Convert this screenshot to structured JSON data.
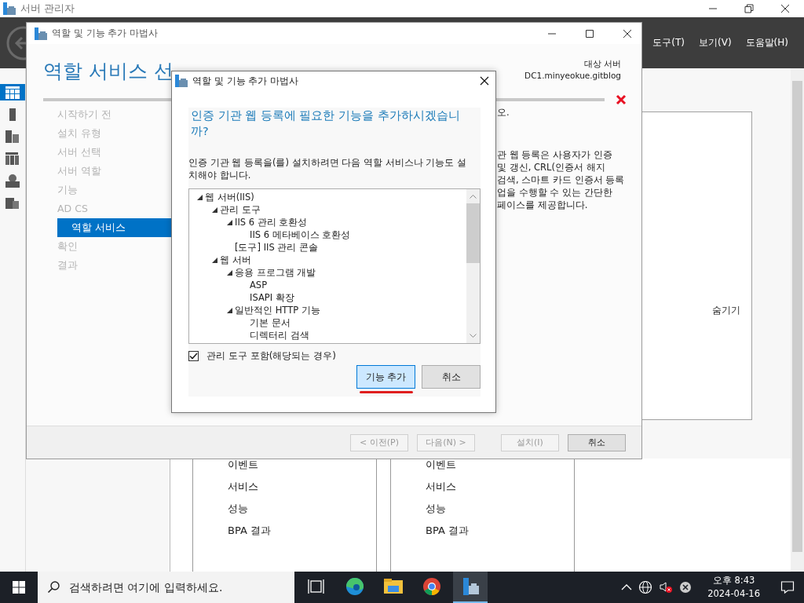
{
  "server_manager": {
    "title": "서버 관리자",
    "menu": [
      {
        "label": "도구(T)"
      },
      {
        "label": "보기(V)"
      },
      {
        "label": "도움말(H)"
      }
    ],
    "nav_icons": [
      {
        "kind": "dashboard",
        "selected": true
      },
      {
        "kind": "local",
        "selected": false
      },
      {
        "kind": "all",
        "selected": false
      },
      {
        "kind": "adcs",
        "selected": false
      },
      {
        "kind": "iis",
        "selected": false
      },
      {
        "kind": "files",
        "selected": false
      }
    ],
    "hide_link": "숨기기",
    "tiles": [
      {
        "items": [
          "이벤트",
          "서비스",
          "성능",
          "BPA 결과"
        ]
      },
      {
        "items": [
          "이벤트",
          "서비스",
          "성능",
          "BPA 결과"
        ]
      }
    ]
  },
  "wizard": {
    "title": "역할 및 기능 추가 마법사",
    "heading": "역할 서비스 선",
    "target_label": "대상 서버",
    "target_server": "DC1.minyeokue.gitblog",
    "steps": [
      {
        "label": "시작하기 전",
        "selected": false
      },
      {
        "label": "설치 유형",
        "selected": false
      },
      {
        "label": "서버 선택",
        "selected": false
      },
      {
        "label": "서버 역할",
        "selected": false
      },
      {
        "label": "기능",
        "selected": false
      },
      {
        "label": "AD CS",
        "selected": false,
        "children": [
          {
            "label": "역할 서비스",
            "selected": true
          }
        ]
      },
      {
        "label": "확인",
        "selected": false
      },
      {
        "label": "결과",
        "selected": false
      }
    ],
    "content_fragments": [
      "오."
    ],
    "description_lines": [
      "관 웹 등록은 사용자가 인증",
      "및 갱신, CRL(인증서 해지",
      "검색, 스마트 카드 인증서 등록",
      "업을 수행할 수 있는 간단한",
      "페이스를 제공합니다."
    ],
    "buttons": [
      {
        "label": "< 이전(P)",
        "disabled": true
      },
      {
        "label": "다음(N) >",
        "disabled": true
      },
      {
        "label": "설치(I)",
        "disabled": true
      },
      {
        "label": "취소",
        "disabled": false
      }
    ]
  },
  "dialog": {
    "title": "역할 및 기능 추가 마법사",
    "heading": "인증 기관 웹 등록에 필요한 기능을 추가하시겠습니까?",
    "message": "인증 기관 웹 등록을(를) 설치하려면 다음 역할 서비스나 기능도 설치해야 합니다.",
    "features": [
      {
        "label": "웹 서버(IIS)",
        "expanded": true,
        "children": [
          {
            "label": "관리 도구",
            "expanded": true,
            "children": [
              {
                "label": "IIS 6 관리 호환성",
                "expanded": true,
                "children": [
                  {
                    "label": "IIS 6 메타베이스 호환성",
                    "expanded": false
                  }
                ]
              },
              {
                "label": "[도구] IIS 관리 콘솔",
                "expanded": false
              }
            ]
          },
          {
            "label": "웹 서버",
            "expanded": true,
            "children": [
              {
                "label": "응용 프로그램 개발",
                "expanded": true,
                "children": [
                  {
                    "label": "ASP",
                    "expanded": false
                  },
                  {
                    "label": "ISAPI 확장",
                    "expanded": false
                  }
                ]
              },
              {
                "label": "일반적인 HTTP 기능",
                "expanded": true,
                "children": [
                  {
                    "label": "기본 문서",
                    "expanded": false
                  },
                  {
                    "label": "디렉터리 검색",
                    "expanded": false
                  }
                ]
              }
            ]
          }
        ]
      }
    ],
    "include_tools": {
      "label": "관리 도구 포함(해당되는 경우)",
      "checked": true
    },
    "buttons": [
      {
        "label": "기능 추가",
        "focused": true
      },
      {
        "label": "취소",
        "focused": false
      }
    ]
  },
  "taskbar": {
    "search_placeholder": "검색하려면 여기에 입력하세요.",
    "apps": [
      {
        "kind": "task-view",
        "active": false
      },
      {
        "kind": "edge",
        "active": false
      },
      {
        "kind": "explorer",
        "active": false
      },
      {
        "kind": "chrome",
        "active": false
      },
      {
        "kind": "server-manager",
        "active": true
      }
    ],
    "time": "오후 8:43",
    "date": "2024-04-16"
  }
}
